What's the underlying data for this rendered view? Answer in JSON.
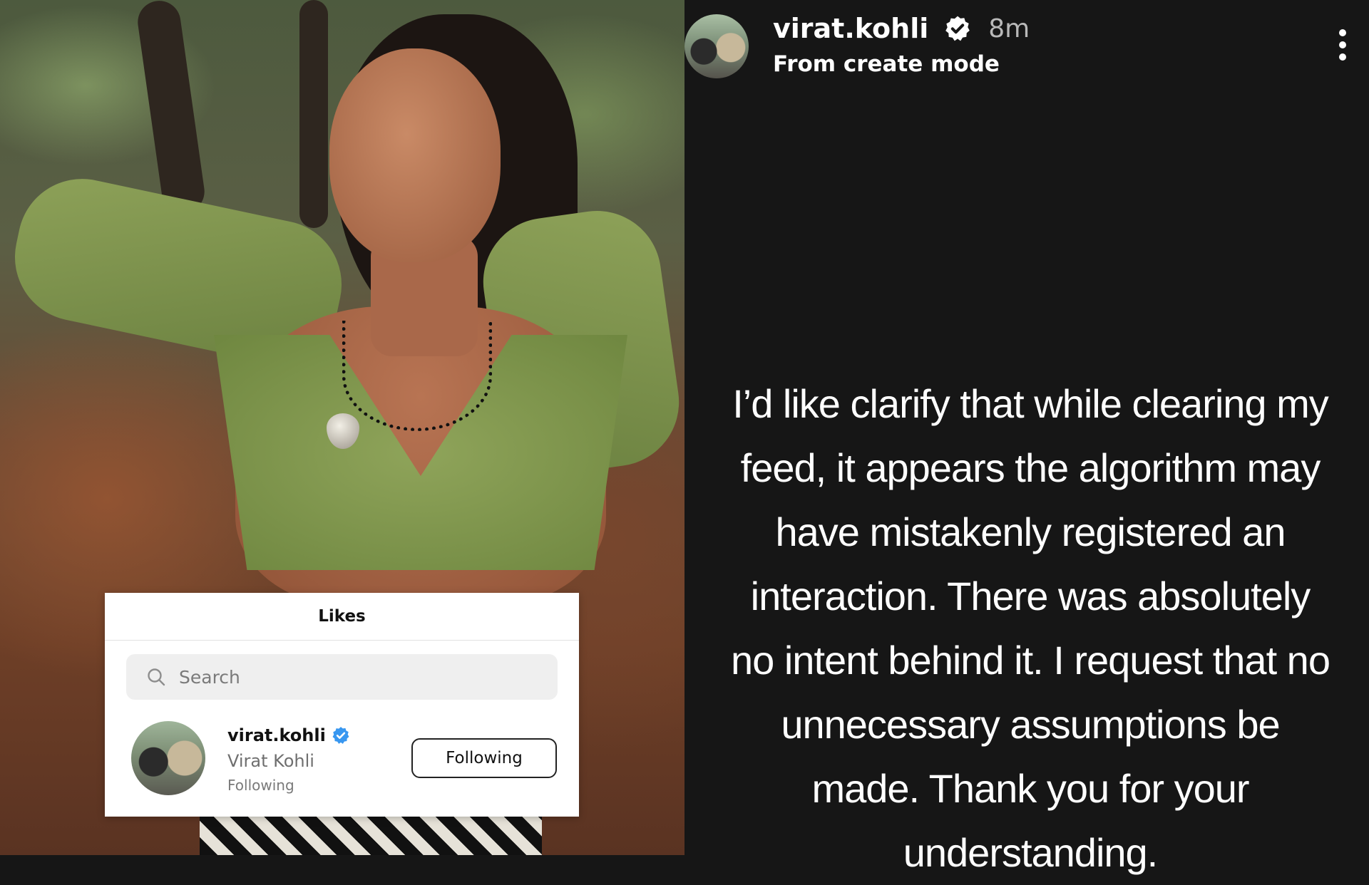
{
  "likes_card": {
    "title": "Likes",
    "search_placeholder": "Search",
    "user": {
      "handle": "virat.kohli",
      "full_name": "Virat Kohli",
      "status": "Following",
      "button_label": "Following"
    }
  },
  "story": {
    "username": "virat.kohli",
    "time": "8m",
    "subtitle": "From create mode",
    "text": "I’d like clarify that while clearing my feed, it appears the algorithm may have mistakenly registered an interaction. There was absolutely no intent behind it. I request that no unnecessary assumptions be made. Thank you for your understanding."
  },
  "colors": {
    "story_background": "#161616",
    "verified_blue": "#3897f0",
    "text_white": "#ffffff"
  },
  "icons": {
    "search": "search-icon",
    "verified": "verified-badge-icon",
    "more": "more-options-icon"
  }
}
